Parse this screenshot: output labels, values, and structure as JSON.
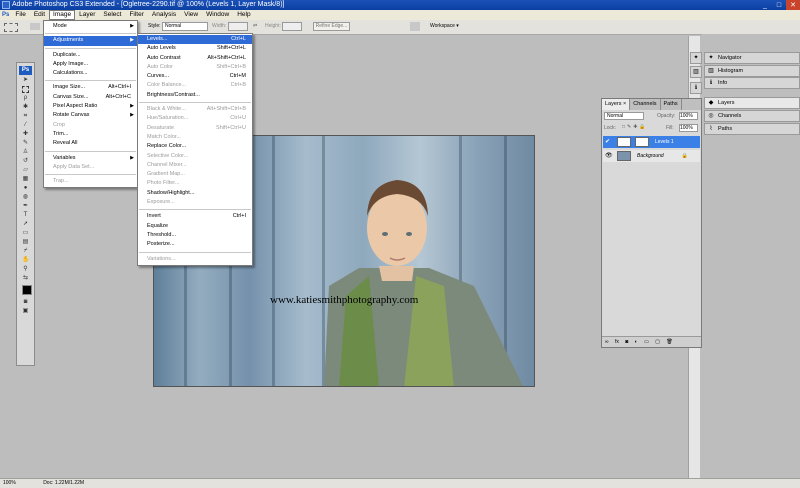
{
  "app": {
    "title": "Adobe Photoshop CS3 Extended - [Ogletree-2290.tif @ 100% (Levels 1, Layer Mask/8)]",
    "window_buttons": [
      "_",
      "□",
      "✕"
    ]
  },
  "menubar": [
    "File",
    "Edit",
    "Image",
    "Layer",
    "Select",
    "Filter",
    "Analysis",
    "View",
    "Window",
    "Help"
  ],
  "options_bar": {
    "style_label": "Style:",
    "style_value": "Normal",
    "width_label": "Width:",
    "height_label": "Height:",
    "refine_edge": "Refine Edge...",
    "workspace": "Workspace ▾"
  },
  "image_menu": [
    {
      "label": "Mode",
      "arrow": true,
      "sep_after": true
    },
    {
      "label": "Adjustments",
      "arrow": true,
      "highlight": true,
      "sep_after": true
    },
    {
      "label": "Duplicate..."
    },
    {
      "label": "Apply Image..."
    },
    {
      "label": "Calculations...",
      "sep_after": true
    },
    {
      "label": "Image Size...",
      "shortcut": "Alt+Ctrl+I"
    },
    {
      "label": "Canvas Size...",
      "shortcut": "Alt+Ctrl+C"
    },
    {
      "label": "Pixel Aspect Ratio",
      "arrow": true
    },
    {
      "label": "Rotate Canvas",
      "arrow": true
    },
    {
      "label": "Crop",
      "disabled": true
    },
    {
      "label": "Trim..."
    },
    {
      "label": "Reveal All",
      "sep_after": true
    },
    {
      "label": "Variables",
      "arrow": true
    },
    {
      "label": "Apply Data Set...",
      "disabled": true,
      "sep_after": true
    },
    {
      "label": "Trap...",
      "disabled": true
    }
  ],
  "adjustments_menu": [
    {
      "label": "Levels...",
      "shortcut": "Ctrl+L",
      "highlight": true
    },
    {
      "label": "Auto Levels",
      "shortcut": "Shift+Ctrl+L"
    },
    {
      "label": "Auto Contrast",
      "shortcut": "Alt+Shift+Ctrl+L"
    },
    {
      "label": "Auto Color",
      "shortcut": "Shift+Ctrl+B",
      "disabled": true
    },
    {
      "label": "Curves...",
      "shortcut": "Ctrl+M"
    },
    {
      "label": "Color Balance...",
      "shortcut": "Ctrl+B",
      "disabled": true
    },
    {
      "label": "Brightness/Contrast...",
      "sep_after": true
    },
    {
      "label": "Black & White...",
      "shortcut": "Alt+Shift+Ctrl+B",
      "disabled": true
    },
    {
      "label": "Hue/Saturation...",
      "shortcut": "Ctrl+U",
      "disabled": true
    },
    {
      "label": "Desaturate",
      "shortcut": "Shift+Ctrl+U",
      "disabled": true
    },
    {
      "label": "Match Color...",
      "disabled": true
    },
    {
      "label": "Replace Color..."
    },
    {
      "label": "Selective Color...",
      "disabled": true
    },
    {
      "label": "Channel Mixer...",
      "disabled": true
    },
    {
      "label": "Gradient Map...",
      "disabled": true
    },
    {
      "label": "Photo Filter...",
      "disabled": true
    },
    {
      "label": "Shadow/Highlight..."
    },
    {
      "label": "Exposure...",
      "disabled": true,
      "sep_after": true
    },
    {
      "label": "Invert",
      "shortcut": "Ctrl+I"
    },
    {
      "label": "Equalize"
    },
    {
      "label": "Threshold..."
    },
    {
      "label": "Posterize...",
      "sep_after": true
    },
    {
      "label": "Variations...",
      "disabled": true
    }
  ],
  "watermark": "www.katiesmithphotography.com",
  "right_panels": [
    "Navigator",
    "Histogram",
    "Info",
    "Layers",
    "Channels",
    "Paths"
  ],
  "layers_panel": {
    "tabs": [
      "Layers ×",
      "Channels",
      "Paths"
    ],
    "blend_mode": "Normal",
    "opacity_label": "Opacity:",
    "opacity_value": "100%",
    "lock_label": "Lock:",
    "fill_label": "Fill:",
    "fill_value": "100%",
    "layers": [
      {
        "name": "Levels 1",
        "selected": true
      },
      {
        "name": "Background",
        "selected": false
      }
    ]
  },
  "status": {
    "zoom": "100%",
    "doc": "Doc: 1.22M/1.22M"
  },
  "colors": {
    "highlight": "#2f6bd6",
    "titlebar": "#0a3ea2",
    "layer_selected": "#3a80e6"
  }
}
